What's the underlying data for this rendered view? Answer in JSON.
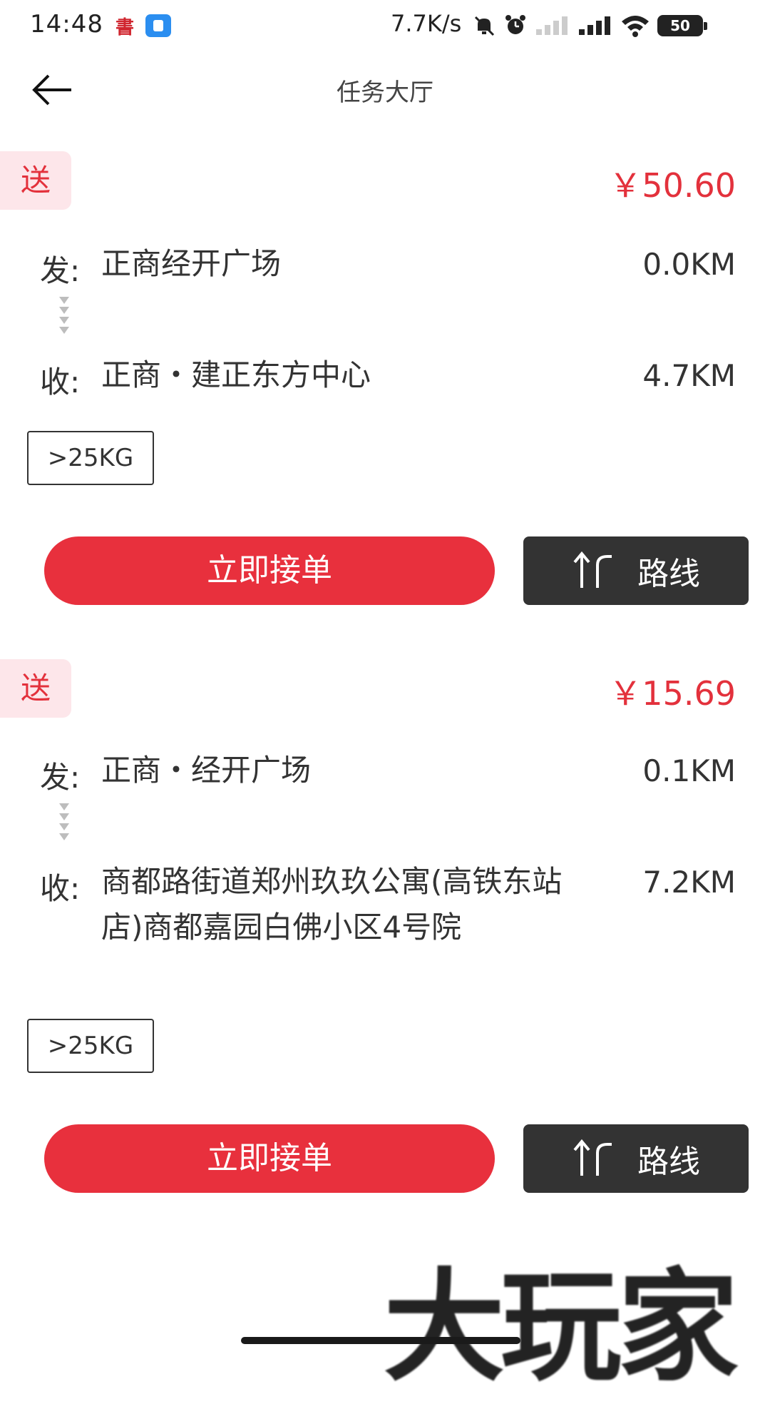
{
  "status_bar": {
    "time": "14:48",
    "net_speed": "7.7K/s",
    "battery": "50"
  },
  "nav": {
    "title": "任务大厅",
    "back_icon": "arrow-left-icon"
  },
  "orders": [
    {
      "type": "送",
      "price": "￥50.60",
      "from_label": "发:",
      "from": "正商经开广场",
      "from_distance": "0.0KM",
      "to_label": "收:",
      "to": "正商・建正东方中心",
      "to_distance": "4.7KM",
      "weight": ">25KG",
      "accept_label": "立即接单",
      "route_label": "路线"
    },
    {
      "type": "送",
      "price": "￥15.69",
      "from_label": "发:",
      "from": "正商・经开广场",
      "from_distance": "0.1KM",
      "to_label": "收:",
      "to": "商都路街道郑州玖玖公寓(高铁东站店)商都嘉园白佛小区4号院",
      "to_distance": "7.2KM",
      "weight": ">25KG",
      "accept_label": "立即接单",
      "route_label": "路线"
    }
  ],
  "watermark": "大玩家",
  "colors": {
    "accent": "#e8303d",
    "badge_bg": "#fde6ea",
    "route_bg": "#333333"
  }
}
